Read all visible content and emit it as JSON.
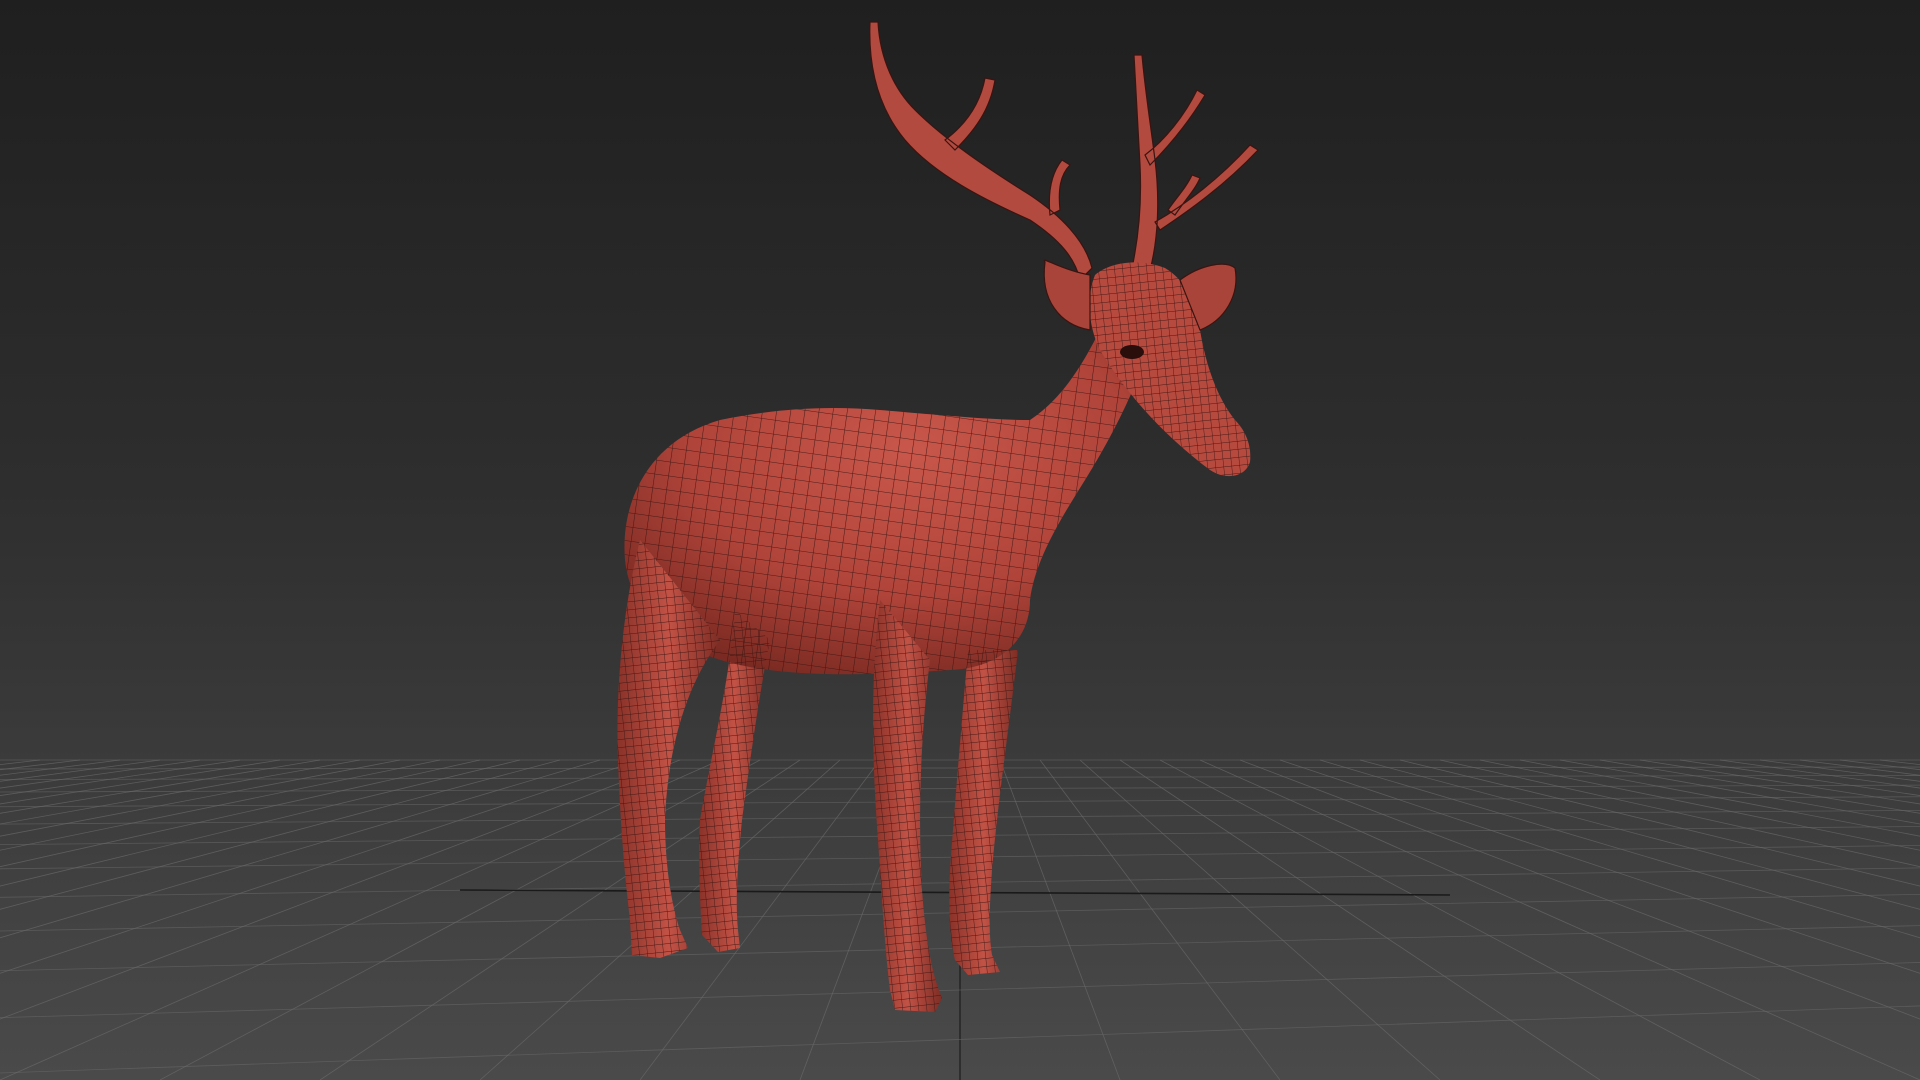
{
  "viewport": {
    "background_top": "#1f1f1f",
    "background_bottom": "#4a4a4a",
    "grid_color": "#6a6a6a",
    "grid_axis_color": "#1a1a1a"
  },
  "model": {
    "subject": "deer",
    "shading": "wireframe-on-shaded",
    "surface_color": "#b8453a",
    "wire_color": "#3a1410"
  }
}
